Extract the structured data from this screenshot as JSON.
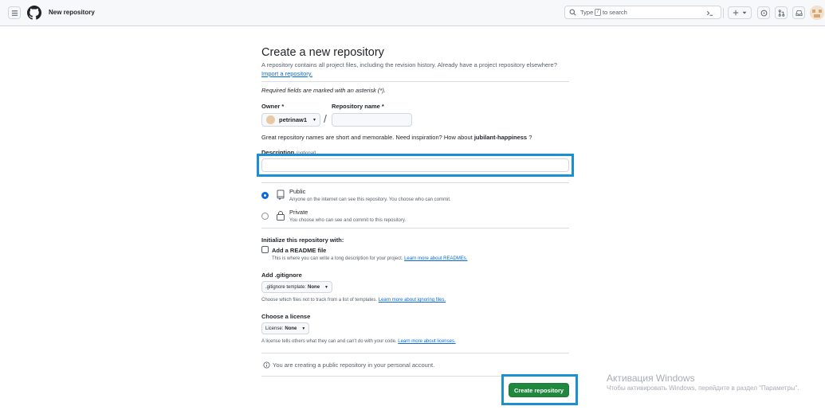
{
  "header": {
    "page_context": "New repository",
    "search_prefix": "Type",
    "search_key": "/",
    "search_suffix": "to search"
  },
  "form": {
    "title": "Create a new repository",
    "subtitle": "A repository contains all project files, including the revision history. Already have a project repository elsewhere?",
    "import_link": "Import a repository.",
    "required_note": "Required fields are marked with an asterisk (*).",
    "owner_label": "Owner *",
    "owner_value": "petrinaw1",
    "slash": "/",
    "repo_name_label": "Repository name *",
    "repo_name_value": "",
    "name_hint_prefix": "Great repository names are short and memorable. Need inspiration? How about",
    "name_hint_suggestion": "jubilant-happiness",
    "name_hint_suffix": "?",
    "description_label": "Description",
    "description_optional": "(optional)",
    "description_value": ""
  },
  "visibility": {
    "public_title": "Public",
    "public_desc": "Anyone on the internet can see this repository. You choose who can commit.",
    "public_selected": true,
    "private_title": "Private",
    "private_desc": "You choose who can see and commit to this repository.",
    "private_selected": false
  },
  "initialize": {
    "title": "Initialize this repository with:",
    "readme_label": "Add a README file",
    "readme_checked": false,
    "readme_desc": "This is where you can write a long description for your project.",
    "readme_link": "Learn more about READMEs."
  },
  "gitignore": {
    "title": "Add .gitignore",
    "select_prefix": ".gitignore template:",
    "select_value": "None",
    "desc": "Choose which files not to track from a list of templates.",
    "link": "Learn more about ignoring files."
  },
  "license": {
    "title": "Choose a license",
    "select_prefix": "License:",
    "select_value": "None",
    "desc": "A license tells others what they can and can't do with your code.",
    "link": "Learn more about licenses."
  },
  "footer": {
    "info": "You are creating a public repository in your personal account.",
    "create_button": "Create repository"
  },
  "watermark": {
    "title": "Активация Windows",
    "subtitle": "Чтобы активировать Windows, перейдите в раздел \"Параметры\"."
  },
  "colors": {
    "primary_button": "#1f883d",
    "link": "#0969da",
    "focus_highlight": "#1a8fd4"
  }
}
